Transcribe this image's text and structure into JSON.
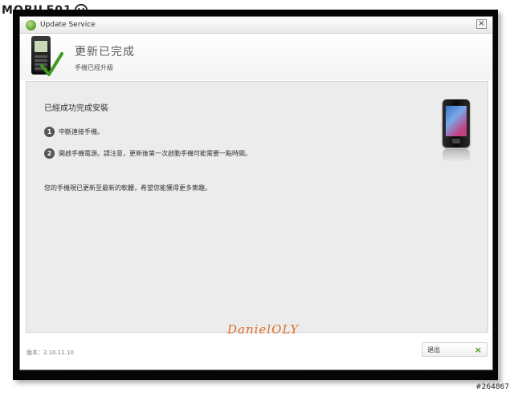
{
  "watermark": {
    "site_logo_text": "MOBILE01"
  },
  "window": {
    "title": "Update Service",
    "close_glyph": "×"
  },
  "header": {
    "title": "更新已完成",
    "subtitle": "手機已經升級"
  },
  "content": {
    "heading": "已經成功完成安裝",
    "steps": [
      {
        "num": "1",
        "text": "中斷連接手機。"
      },
      {
        "num": "2",
        "text": "開啟手機電源。請注意，更新後第一次啟動手機可能需要一點時間。"
      }
    ],
    "note": "您的手機現已更新至最新的軟體，希望您能獲得更多樂趣。"
  },
  "signature": "DanielOLY",
  "footer": {
    "version": "版本：2.10.11.10",
    "exit_label": "退出",
    "exit_icon": "×"
  },
  "photo_id": "#264867",
  "colors": {
    "accent_green": "#4a9a1a",
    "signature_orange": "#e0702c"
  }
}
